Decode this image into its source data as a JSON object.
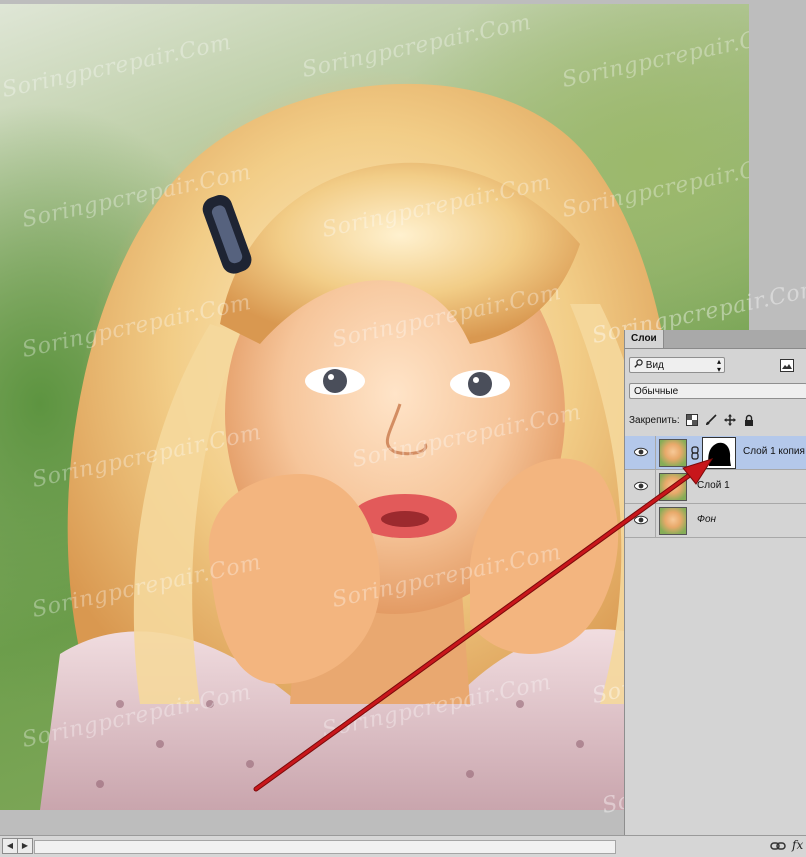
{
  "watermark": {
    "text": "Soringpcrepair.Com"
  },
  "layers_panel": {
    "tab_label": "Слои",
    "filter_select": {
      "icon": "search-icon",
      "value": "Вид"
    },
    "blend_mode": {
      "value": "Обычные"
    },
    "lock_label": "Закрепить:",
    "lock_icons": [
      "lock-transparent-pixels-icon",
      "brush-icon",
      "move-icon",
      "lock-icon"
    ],
    "layers": [
      {
        "name": "Слой 1 копия",
        "selected": true,
        "has_mask": true,
        "italic": false
      },
      {
        "name": "Слой 1",
        "selected": false,
        "has_mask": false,
        "italic": false
      },
      {
        "name": "Фон",
        "selected": false,
        "has_mask": false,
        "italic": true
      }
    ]
  },
  "bottom_bar": {
    "fx_label": "fx"
  },
  "colors": {
    "annotation_arrow": "#c8161b",
    "selected_layer": "#b4c8ea"
  }
}
